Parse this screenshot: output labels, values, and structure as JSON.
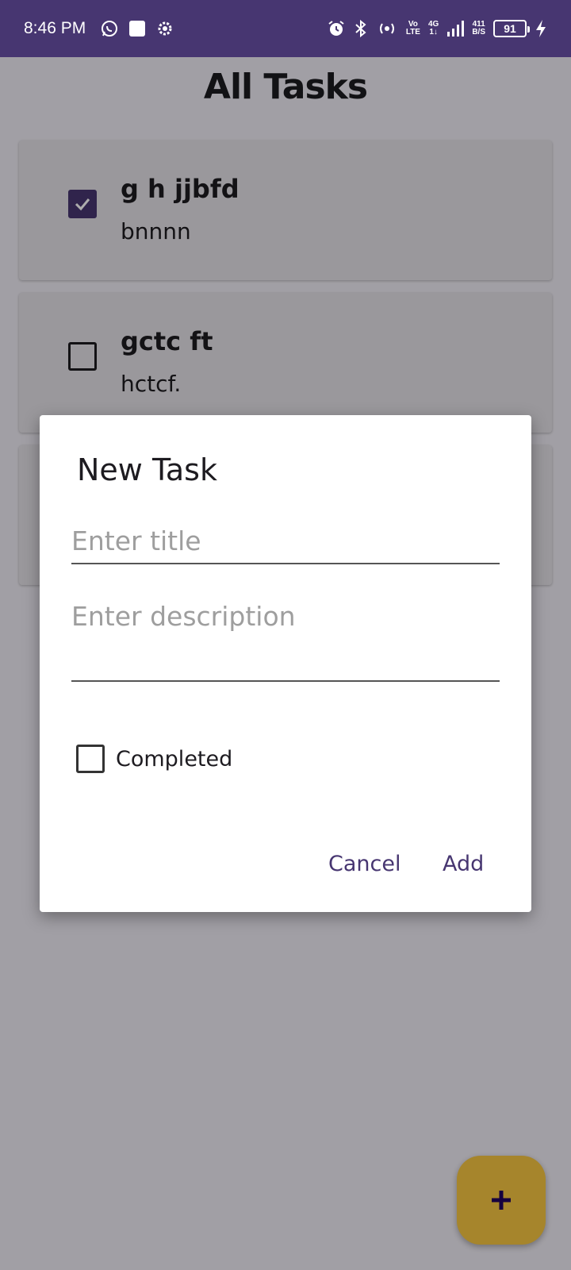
{
  "status_bar": {
    "time": "8:46 PM",
    "icons": [
      "whatsapp-icon",
      "square-notification-icon",
      "settings-icon",
      "alarm-icon",
      "bluetooth-icon",
      "hotspot-icon",
      "volte-icon",
      "signal-icon"
    ],
    "volte_top": "Vo",
    "volte_bottom": "LTE",
    "network_top": "4G",
    "network_bottom": "1↓",
    "speed_value": "411",
    "speed_unit": "B/S",
    "battery": "91"
  },
  "header": {
    "title": "All Tasks"
  },
  "tasks": [
    {
      "title": "g h jjbfd",
      "description": "bnnnn",
      "completed": true
    },
    {
      "title": "gctc ft",
      "description": "hctcf.",
      "completed": false
    },
    {
      "title": "",
      "description": "",
      "completed": false
    }
  ],
  "dialog": {
    "title": "New Task",
    "title_placeholder": "Enter title",
    "title_value": "",
    "description_placeholder": "Enter description",
    "description_value": "",
    "completed_label": "Completed",
    "completed": false,
    "cancel_label": "Cancel",
    "add_label": "Add"
  },
  "fab": {
    "icon": "plus-icon"
  },
  "colors": {
    "primary": "#473671",
    "fab": "#f5c542",
    "background": "#eeebf3",
    "card": "#e4e1e6"
  }
}
